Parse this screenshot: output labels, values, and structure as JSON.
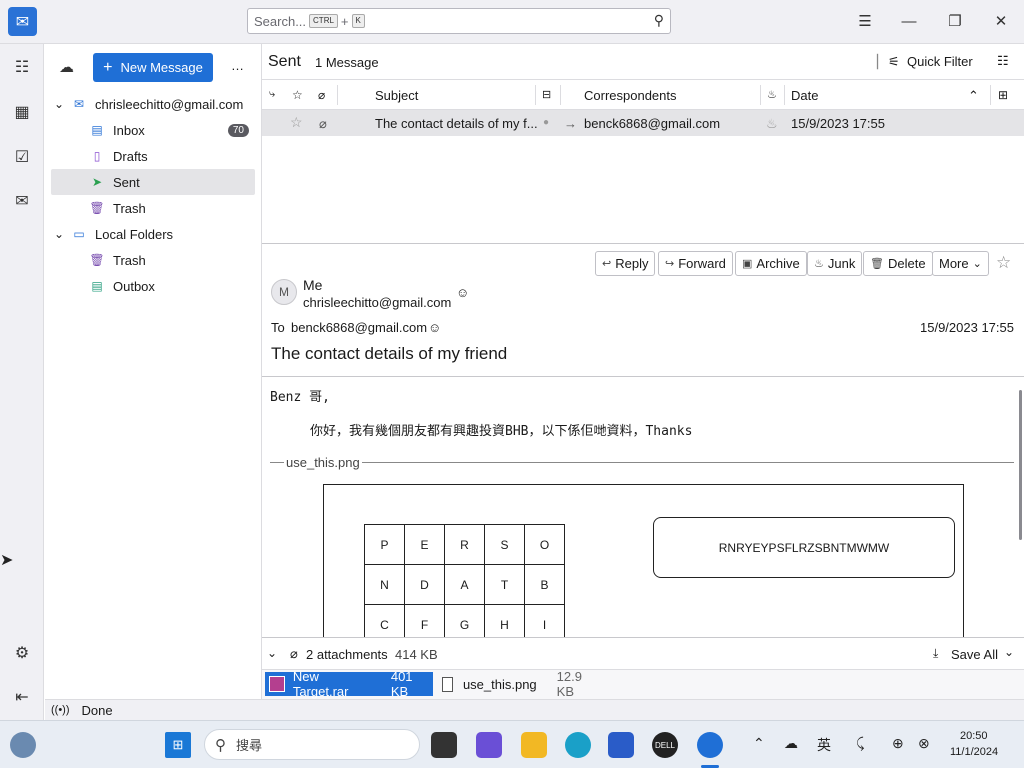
{
  "search": {
    "placeholder": "Search...",
    "shortcut_key1": "CTRL",
    "shortcut_plus": "+",
    "shortcut_key2": "K"
  },
  "toolbar": {
    "new_message_label": "New Message",
    "more_label": "…"
  },
  "folders": {
    "account": "chrisleechitto@gmail.com",
    "items": [
      {
        "label": "Inbox",
        "badge": "70"
      },
      {
        "label": "Drafts"
      },
      {
        "label": "Sent"
      },
      {
        "label": "Trash"
      }
    ],
    "local_label": "Local Folders",
    "local_items": [
      {
        "label": "Trash"
      },
      {
        "label": "Outbox"
      }
    ]
  },
  "list": {
    "folder_name": "Sent",
    "count_label": "1 Message",
    "quick_filter_label": "Quick Filter",
    "columns": {
      "subject": "Subject",
      "correspondents": "Correspondents",
      "date": "Date"
    },
    "rows": [
      {
        "subject": "The contact details of my f...",
        "correspondent": "benck6868@gmail.com",
        "date": "15/9/2023 17:55"
      }
    ]
  },
  "header": {
    "buttons": {
      "reply": "Reply",
      "forward": "Forward",
      "archive": "Archive",
      "junk": "Junk",
      "delete": "Delete",
      "more": "More"
    },
    "avatar_initial": "M",
    "from_name": "Me",
    "from_email": "chrisleechitto@gmail.com",
    "to_label": "To",
    "to_email": "benck6868@gmail.com",
    "date": "15/9/2023 17:55",
    "subject": "The contact details of my friend"
  },
  "body": {
    "greeting": "Benz 哥,",
    "line1": "你好，我有幾個朋友都有興趣投資BHB，以下係佢哋資料，Thanks",
    "attachment_name": "use_this.png",
    "grid": [
      [
        "P",
        "E",
        "R",
        "S",
        "O"
      ],
      [
        "N",
        "D",
        "A",
        "T",
        "B"
      ],
      [
        "C",
        "F",
        "G",
        "H",
        "I"
      ]
    ],
    "code": "RNRYEYPSFLRZSBNTMWMW"
  },
  "attachments": {
    "summary": "2 attachments",
    "total_size": "414 KB",
    "save_all_label": "Save All",
    "files": [
      {
        "name": "New Target.rar",
        "size": "401 KB"
      },
      {
        "name": "use_this.png",
        "size": "12.9 KB"
      }
    ]
  },
  "status": {
    "text": "Done"
  },
  "taskbar": {
    "search_label": "搜尋",
    "ime_label": "英",
    "time": "20:50",
    "date": "11/1/2024"
  }
}
